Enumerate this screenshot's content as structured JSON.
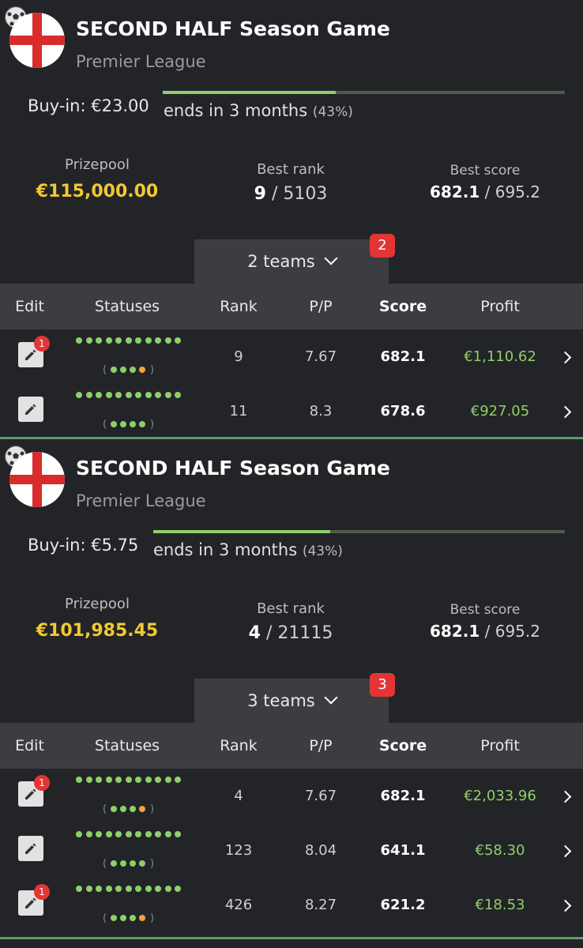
{
  "colors": {
    "accent_green": "#8fcf6a",
    "prize_gold": "#f1c932",
    "badge_red": "#e33535",
    "divider_green": "#5e9a63"
  },
  "icons": {
    "sport": "soccer-ball-icon",
    "flag": "england-flag-icon",
    "edit": "pencil-icon",
    "expand": "chevron-down-icon",
    "open": "chevron-right-icon"
  },
  "columns": {
    "edit": "Edit",
    "statuses": "Statuses",
    "rank": "Rank",
    "pp": "P/P",
    "score": "Score",
    "profit": "Profit"
  },
  "contests": [
    {
      "title": "SECOND HALF Season Game",
      "league": "Premier League",
      "buyin": "Buy-in: €23.00",
      "ends": "ends in 3 months",
      "ends_pct": "(43%)",
      "progress_pct": 43,
      "prizepool_label": "Prizepool",
      "prizepool": "€115,000.00",
      "best_rank_label": "Best rank",
      "best_rank": "9",
      "best_rank_total": " / 5103",
      "best_score_label": "Best score",
      "best_score": "682.1",
      "best_score_total": " / 695.2",
      "teams_label": "2 teams",
      "teams_badge": "2",
      "rows": [
        {
          "badge": "1",
          "status_dots": 11,
          "sub_dots": [
            "green",
            "green",
            "green",
            "orange"
          ],
          "rank": "9",
          "pp": "7.67",
          "score": "682.1",
          "profit": "€1,110.62"
        },
        {
          "badge": "",
          "status_dots": 11,
          "sub_dots": [
            "green",
            "green",
            "green",
            "green"
          ],
          "rank": "11",
          "pp": "8.3",
          "score": "678.6",
          "profit": "€927.05"
        }
      ]
    },
    {
      "title": "SECOND HALF Season Game",
      "league": "Premier League",
      "buyin": "Buy-in: €5.75",
      "ends": "ends in 3 months",
      "ends_pct": "(43%)",
      "progress_pct": 43,
      "prizepool_label": "Prizepool",
      "prizepool": "€101,985.45",
      "best_rank_label": "Best rank",
      "best_rank": "4",
      "best_rank_total": " / 21115",
      "best_score_label": "Best score",
      "best_score": "682.1",
      "best_score_total": " / 695.2",
      "teams_label": "3 teams",
      "teams_badge": "3",
      "rows": [
        {
          "badge": "1",
          "status_dots": 11,
          "sub_dots": [
            "green",
            "green",
            "green",
            "orange"
          ],
          "rank": "4",
          "pp": "7.67",
          "score": "682.1",
          "profit": "€2,033.96"
        },
        {
          "badge": "",
          "status_dots": 11,
          "sub_dots": [
            "green",
            "green",
            "green",
            "green"
          ],
          "rank": "123",
          "pp": "8.04",
          "score": "641.1",
          "profit": "€58.30"
        },
        {
          "badge": "1",
          "status_dots": 11,
          "sub_dots": [
            "green",
            "green",
            "green",
            "orange"
          ],
          "rank": "426",
          "pp": "8.27",
          "score": "621.2",
          "profit": "€18.53"
        }
      ]
    }
  ]
}
